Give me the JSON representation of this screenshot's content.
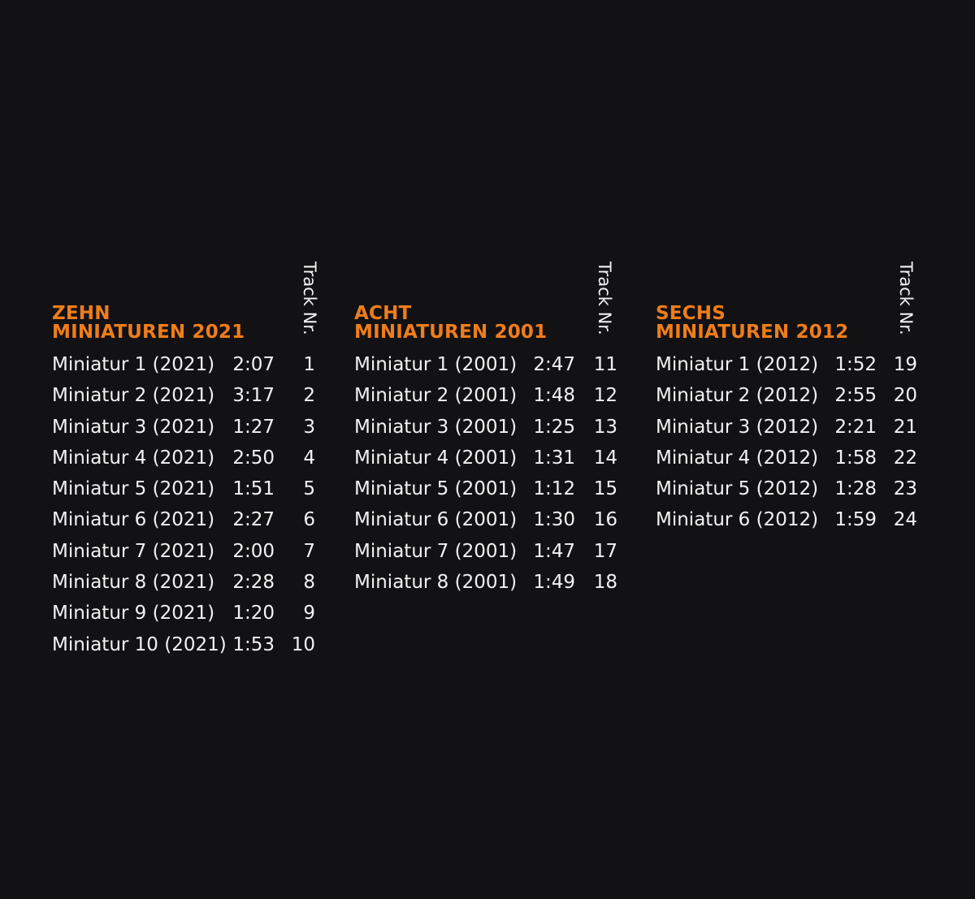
{
  "track_label": "Track Nr.",
  "sections": [
    {
      "title_line1": "ZEHN",
      "title_line2": "MINIATUREN 2021",
      "tracks": [
        {
          "name": "Miniatur 1 (2021)",
          "duration": "2:07",
          "number": "1"
        },
        {
          "name": "Miniatur 2 (2021)",
          "duration": "3:17",
          "number": "2"
        },
        {
          "name": "Miniatur 3 (2021)",
          "duration": "1:27",
          "number": "3"
        },
        {
          "name": "Miniatur 4 (2021)",
          "duration": "2:50",
          "number": "4"
        },
        {
          "name": "Miniatur 5 (2021)",
          "duration": "1:51",
          "number": "5"
        },
        {
          "name": "Miniatur 6 (2021)",
          "duration": "2:27",
          "number": "6"
        },
        {
          "name": "Miniatur 7 (2021)",
          "duration": "2:00",
          "number": "7"
        },
        {
          "name": "Miniatur 8 (2021)",
          "duration": "2:28",
          "number": "8"
        },
        {
          "name": "Miniatur 9 (2021)",
          "duration": "1:20",
          "number": "9"
        },
        {
          "name": "Miniatur 10 (2021)",
          "duration": "1:53",
          "number": "10"
        }
      ]
    },
    {
      "title_line1": "ACHT",
      "title_line2": "MINIATUREN 2001",
      "tracks": [
        {
          "name": "Miniatur 1 (2001)",
          "duration": "2:47",
          "number": "11"
        },
        {
          "name": "Miniatur 2 (2001)",
          "duration": "1:48",
          "number": "12"
        },
        {
          "name": "Miniatur 3 (2001)",
          "duration": "1:25",
          "number": "13"
        },
        {
          "name": "Miniatur 4 (2001)",
          "duration": "1:31",
          "number": "14"
        },
        {
          "name": "Miniatur 5 (2001)",
          "duration": "1:12",
          "number": "15"
        },
        {
          "name": "Miniatur 6 (2001)",
          "duration": "1:30",
          "number": "16"
        },
        {
          "name": "Miniatur 7 (2001)",
          "duration": "1:47",
          "number": "17"
        },
        {
          "name": "Miniatur 8 (2001)",
          "duration": "1:49",
          "number": "18"
        }
      ]
    },
    {
      "title_line1": "SECHS",
      "title_line2": "MINIATUREN 2012",
      "tracks": [
        {
          "name": "Miniatur 1 (2012)",
          "duration": "1:52",
          "number": "19"
        },
        {
          "name": "Miniatur 2 (2012)",
          "duration": "2:55",
          "number": "20"
        },
        {
          "name": "Miniatur 3 (2012)",
          "duration": "2:21",
          "number": "21"
        },
        {
          "name": "Miniatur 4 (2012)",
          "duration": "1:58",
          "number": "22"
        },
        {
          "name": "Miniatur 5 (2012)",
          "duration": "1:28",
          "number": "23"
        },
        {
          "name": "Miniatur 6 (2012)",
          "duration": "1:59",
          "number": "24"
        }
      ]
    }
  ]
}
